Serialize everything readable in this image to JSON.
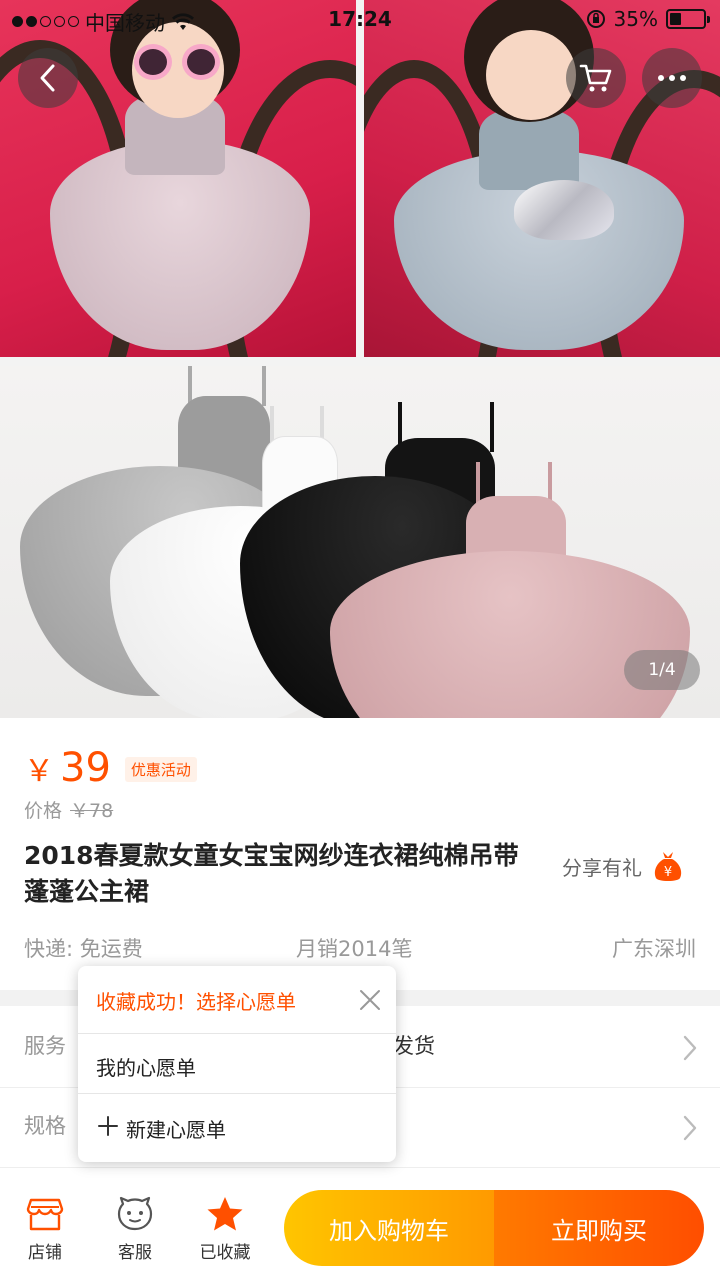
{
  "status_bar": {
    "carrier": "中国移动",
    "time": "17:24",
    "battery": "35%",
    "battery_level": 0.35,
    "signal_bars_filled": 2,
    "signal_bars_total": 5
  },
  "gallery": {
    "page_indicator": "1/4"
  },
  "product": {
    "currency": "￥",
    "price": "39",
    "promo_tag": "优惠活动",
    "original_price_label": "价格",
    "original_price": "￥78",
    "title": "2018春夏款女童女宝宝网纱连衣裙纯棉吊带蓬蓬公主裙",
    "share_label": "分享有礼",
    "delivery": "快递: 免运费",
    "monthly_sales": "月销2014笔",
    "location": "广东深圳"
  },
  "options": {
    "services_label": "服务",
    "services_value": "内发货",
    "spec_label": "规格"
  },
  "wishlist_popup": {
    "title": "收藏成功！选择心愿单",
    "my_wishlist": "我的心愿单",
    "new_wishlist": "新建心愿单"
  },
  "bottom_bar": {
    "shop": "店铺",
    "service": "客服",
    "favorited": "已收藏",
    "add_to_cart": "加入购物车",
    "buy_now": "立即购买"
  },
  "colors": {
    "accent": "#ff5000",
    "cart_button": "#ffb000",
    "buy_button": "#ff5a00"
  },
  "icons": [
    "back-icon",
    "cart-icon",
    "more-icon",
    "money-bag-icon",
    "close-icon",
    "plus-icon",
    "shop-icon",
    "service-icon",
    "star-icon",
    "chevron-right-icon"
  ]
}
